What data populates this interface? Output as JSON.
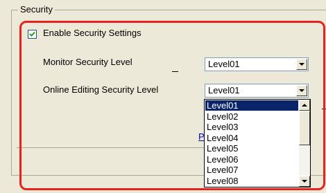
{
  "group": {
    "title": "Security"
  },
  "enable_checkbox": {
    "label": "Enable Security Settings",
    "checked": true
  },
  "monitor_level": {
    "label": "Monitor Security Level",
    "value": "Level01"
  },
  "online_level": {
    "label": "Online Editing Security Level",
    "value": "Level01",
    "options": [
      "Level01",
      "Level02",
      "Level03",
      "Level04",
      "Level05",
      "Level06",
      "Level07",
      "Level08"
    ],
    "selected_index": 0
  },
  "behind_text": "P",
  "colors": {
    "highlight": "#e8211c",
    "selection": "#0a246a",
    "link": "#0000cc"
  },
  "icons": [
    "check-icon",
    "dropdown-arrow-icon",
    "scroll-up-icon",
    "scroll-down-icon"
  ]
}
